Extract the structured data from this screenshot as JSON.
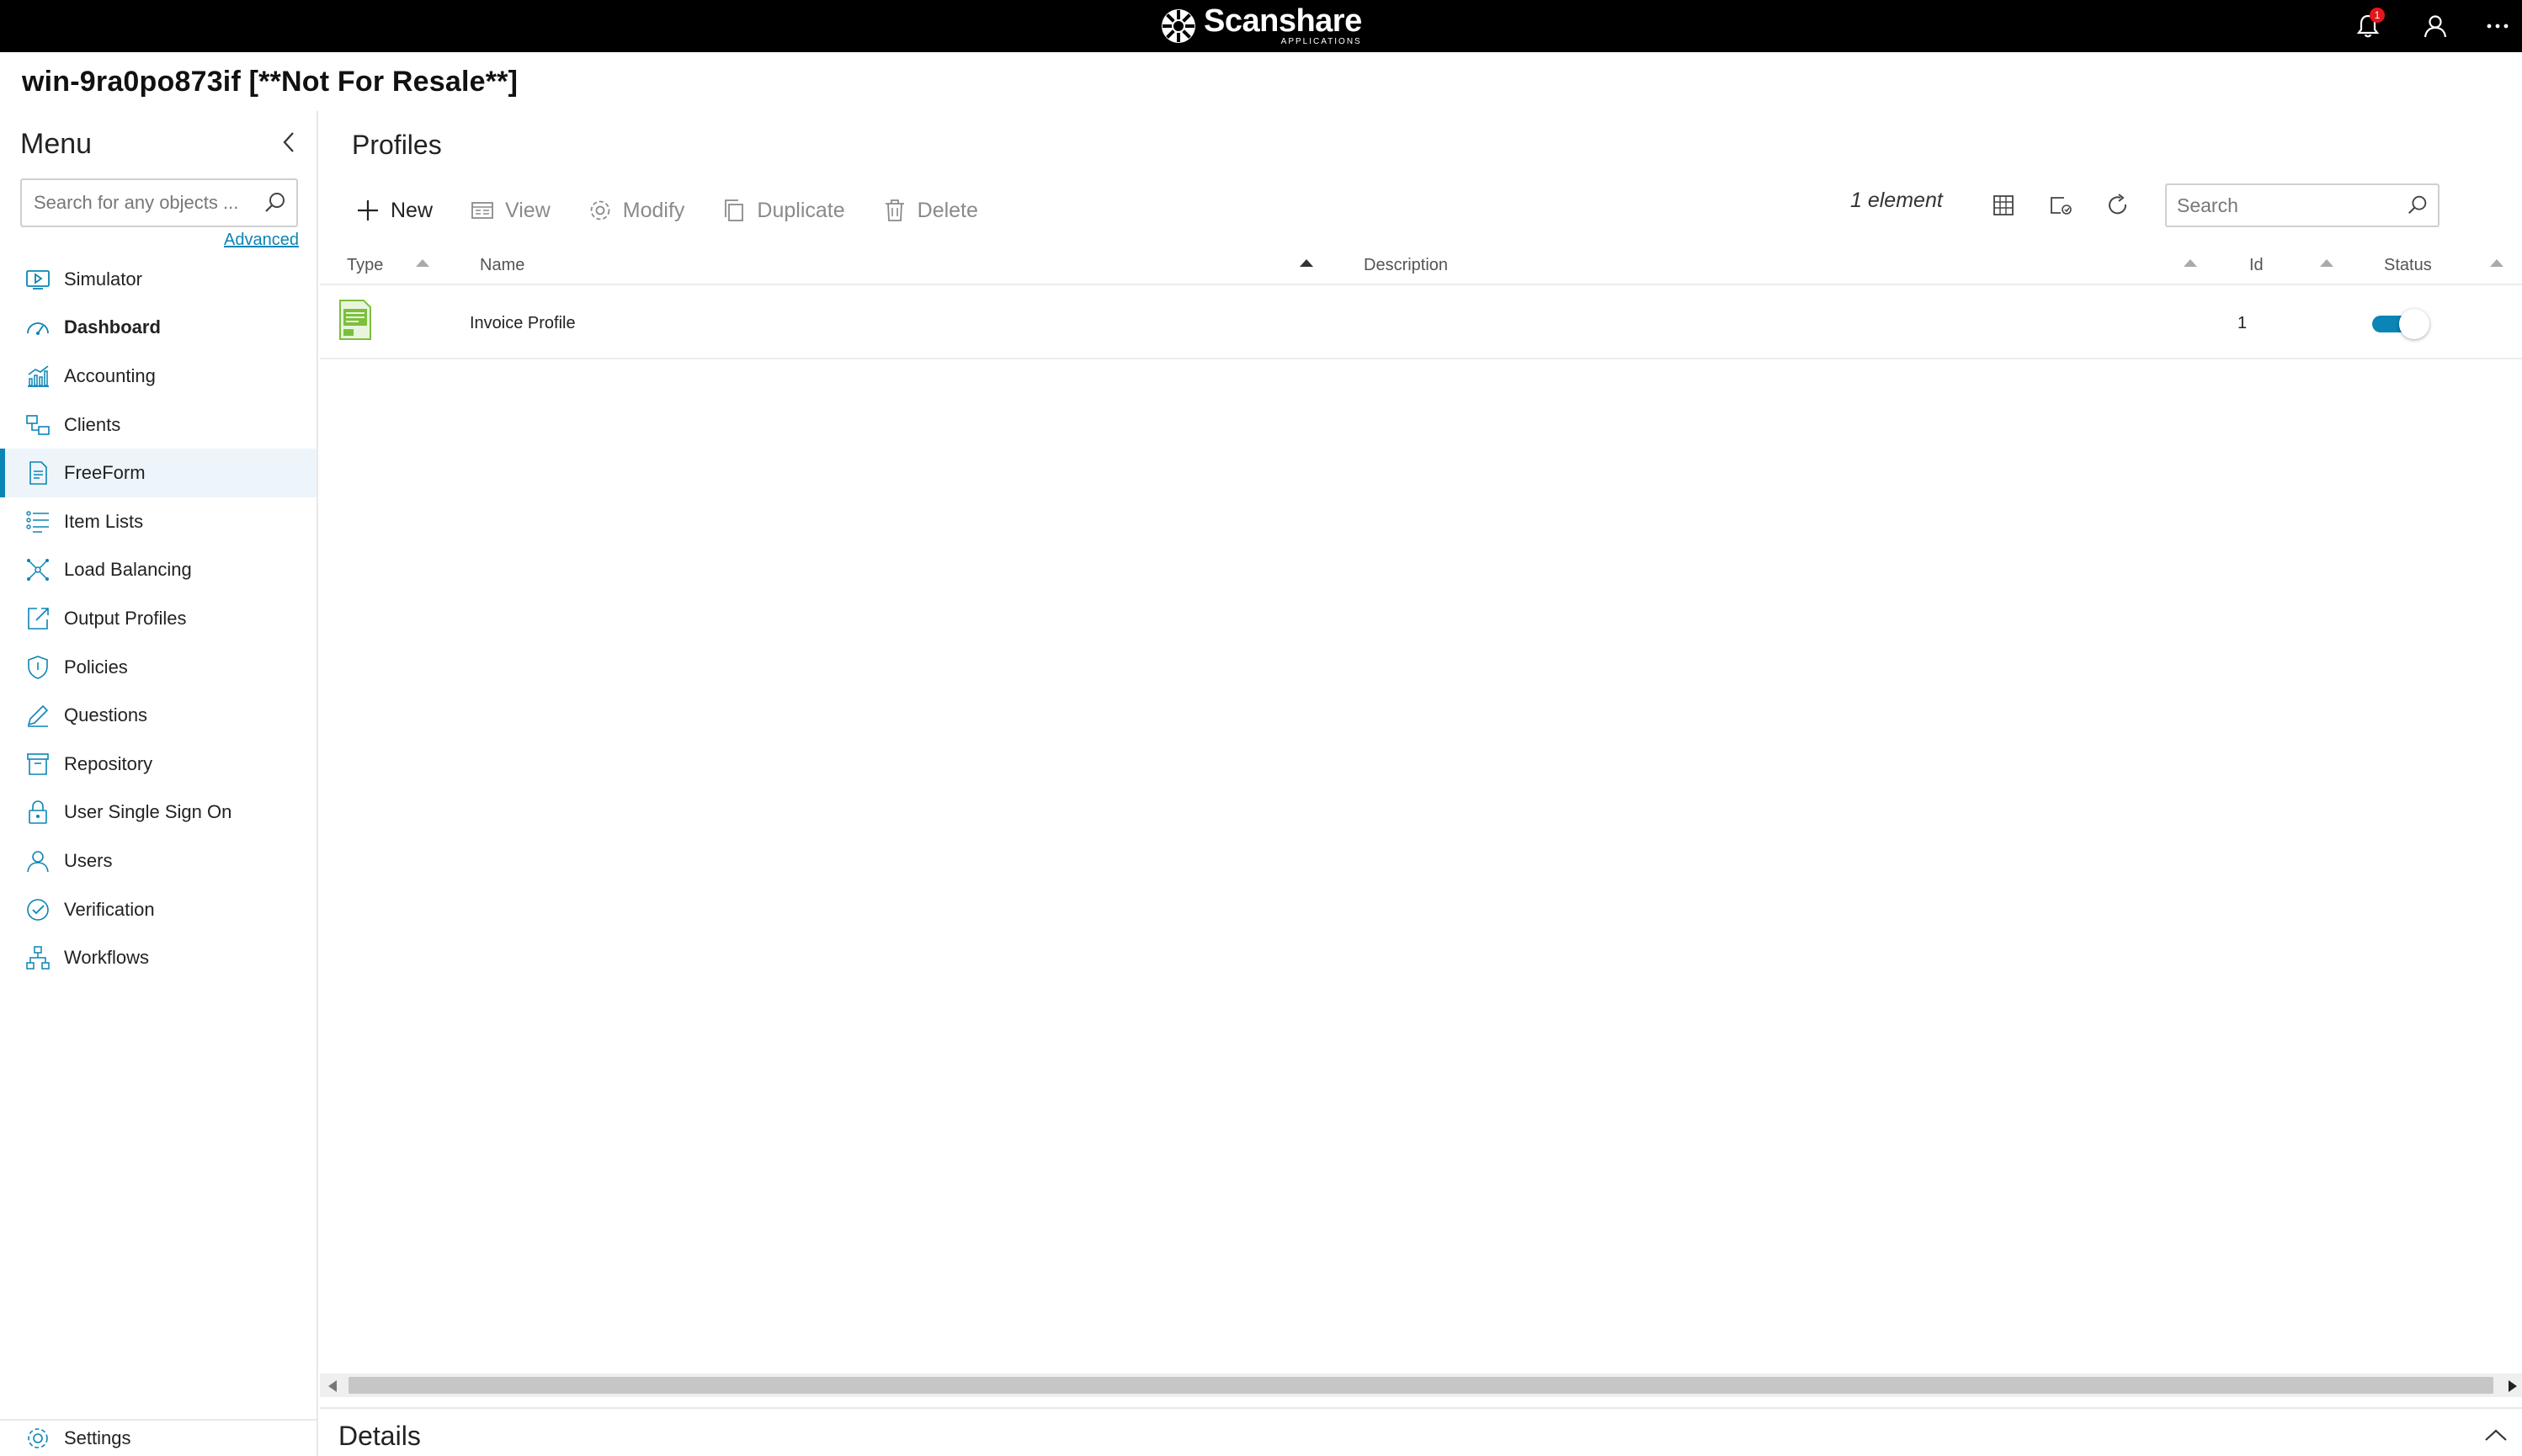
{
  "brand": {
    "name": "Scanshare",
    "sub": "APPLICATIONS"
  },
  "header": {
    "notification_count": "1"
  },
  "host": {
    "title": "win-9ra0po873if [**Not For Resale**]"
  },
  "sidebar": {
    "title": "Menu",
    "search_placeholder": "Search for any objects ...",
    "advanced_label": "Advanced",
    "items": [
      {
        "label": "Simulator",
        "icon": "simulator-icon"
      },
      {
        "label": "Dashboard",
        "icon": "dashboard-icon"
      },
      {
        "label": "Accounting",
        "icon": "accounting-icon"
      },
      {
        "label": "Clients",
        "icon": "clients-icon"
      },
      {
        "label": "FreeForm",
        "icon": "freeform-icon"
      },
      {
        "label": "Item Lists",
        "icon": "item-lists-icon"
      },
      {
        "label": "Load Balancing",
        "icon": "load-balancing-icon"
      },
      {
        "label": "Output Profiles",
        "icon": "output-profiles-icon"
      },
      {
        "label": "Policies",
        "icon": "policies-icon"
      },
      {
        "label": "Questions",
        "icon": "questions-icon"
      },
      {
        "label": "Repository",
        "icon": "repository-icon"
      },
      {
        "label": "User Single Sign On",
        "icon": "sso-icon"
      },
      {
        "label": "Users",
        "icon": "users-icon"
      },
      {
        "label": "Verification",
        "icon": "verification-icon"
      },
      {
        "label": "Workflows",
        "icon": "workflows-icon"
      }
    ],
    "settings_label": "Settings"
  },
  "main": {
    "title": "Profiles",
    "toolbar": {
      "new_label": "New",
      "view_label": "View",
      "modify_label": "Modify",
      "duplicate_label": "Duplicate",
      "delete_label": "Delete"
    },
    "element_count": "1 element",
    "search_placeholder": "Search",
    "columns": {
      "type": "Type",
      "name": "Name",
      "description": "Description",
      "id": "Id",
      "status": "Status"
    },
    "rows": [
      {
        "name": "Invoice Profile",
        "description": "",
        "id": "1",
        "status": "enabled"
      }
    ]
  },
  "details": {
    "title": "Details"
  },
  "colors": {
    "accent": "#0a85b5",
    "type_icon": "#7cbf3c",
    "topbar": "#000000",
    "badge": "#e3161b"
  }
}
